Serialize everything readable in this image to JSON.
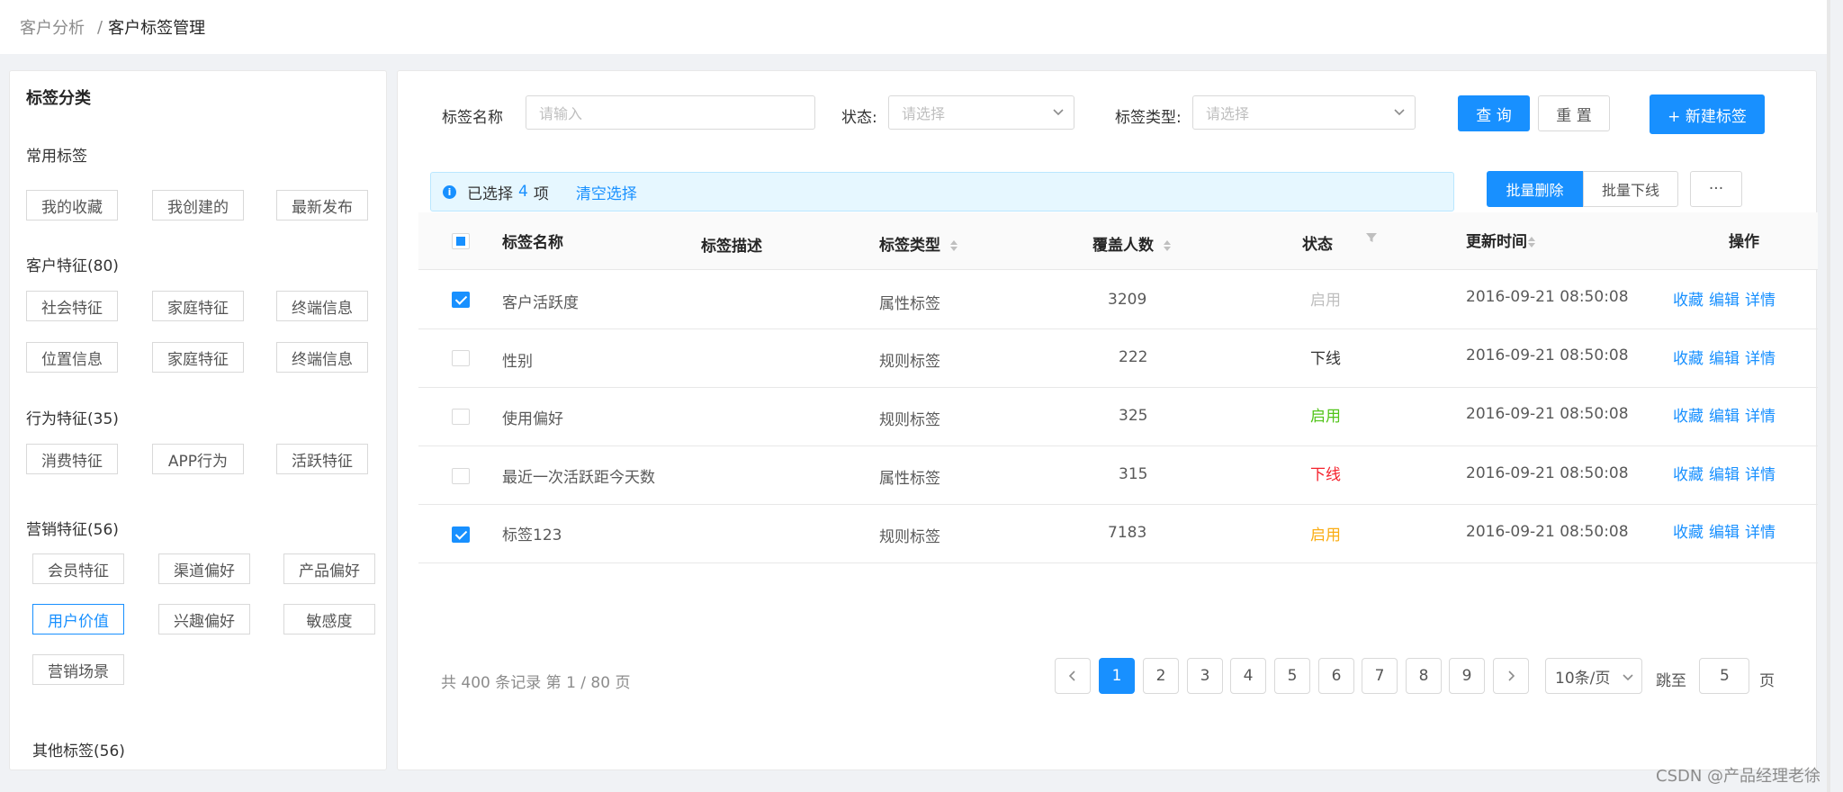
{
  "breadcrumb": {
    "parent": "客户分析",
    "separator": "/",
    "current": "客户标签管理"
  },
  "sidebar": {
    "title": "标签分类",
    "groups": [
      {
        "title": "常用标签",
        "tags": [
          "我的收藏",
          "我创建的",
          "最新发布"
        ]
      },
      {
        "title": "客户特征(80)",
        "tags": [
          "社会特征",
          "家庭特征",
          "终端信息",
          "位置信息",
          "家庭特征",
          "终端信息"
        ]
      },
      {
        "title": "行为特征(35)",
        "tags": [
          "消费特征",
          "APP行为",
          "活跃特征"
        ]
      },
      {
        "title": "营销特征(56)",
        "tags": [
          "会员特征",
          "渠道偏好",
          "产品偏好",
          "用户价值",
          "兴趣偏好",
          "敏感度",
          "营销场景"
        ],
        "active": "用户价值"
      },
      {
        "title": "其他标签(56)",
        "tags": []
      }
    ]
  },
  "filters": {
    "name_label": "标签名称",
    "name_placeholder": "请输入",
    "status_label": "状态:",
    "status_placeholder": "请选择",
    "type_label": "标签类型:",
    "type_placeholder": "请选择",
    "query_button": "查 询",
    "reset_button": "重 置",
    "new_button": "+ 新建标签"
  },
  "selection": {
    "prefix": "已选择",
    "count": "4",
    "suffix": "项",
    "clear": "清空选择",
    "batch_delete": "批量删除",
    "batch_offline": "批量下线",
    "more": "···"
  },
  "table": {
    "columns": [
      "标签名称",
      "标签描述",
      "标签类型",
      "覆盖人数",
      "状态",
      "更新时间",
      "操作"
    ],
    "rows": [
      {
        "checked": true,
        "name": "客户活跃度",
        "desc": "",
        "type": "属性标签",
        "coverage": "3209",
        "status": "启用",
        "status_color": "#bfbfbf",
        "updated": "2016-09-21  08:50:08"
      },
      {
        "checked": false,
        "name": "性别",
        "desc": "",
        "type": "规则标签",
        "coverage": "222",
        "status": "下线",
        "status_color": "#333333",
        "updated": "2016-09-21  08:50:08"
      },
      {
        "checked": false,
        "name": "使用偏好",
        "desc": "",
        "type": "规则标签",
        "coverage": "325",
        "status": "启用",
        "status_color": "#52c41a",
        "updated": "2016-09-21  08:50:08"
      },
      {
        "checked": false,
        "name": "最近一次活跃距今天数",
        "desc": "",
        "type": "属性标签",
        "coverage": "315",
        "status": "下线",
        "status_color": "#f5222d",
        "updated": "2016-09-21  08:50:08"
      },
      {
        "checked": true,
        "name": "标签123",
        "desc": "",
        "type": "规则标签",
        "coverage": "7183",
        "status": "启用",
        "status_color": "#faad14",
        "updated": "2016-09-21  08:50:08"
      }
    ],
    "actions": [
      "收藏",
      "编辑",
      "详情"
    ]
  },
  "pagination": {
    "total_text": "共 400 条记录 第 1 / 80 页",
    "pages": [
      "1",
      "2",
      "3",
      "4",
      "5",
      "6",
      "7",
      "8",
      "9"
    ],
    "current": "1",
    "page_size": "10条/页",
    "jump_label": "跳至",
    "jump_value": "5",
    "page_unit": "页"
  },
  "watermark": "CSDN @产品经理老徐",
  "colors": {
    "primary": "#1890ff",
    "alert_bg": "#e6f7ff",
    "page_bg": "#f0f2f5"
  }
}
